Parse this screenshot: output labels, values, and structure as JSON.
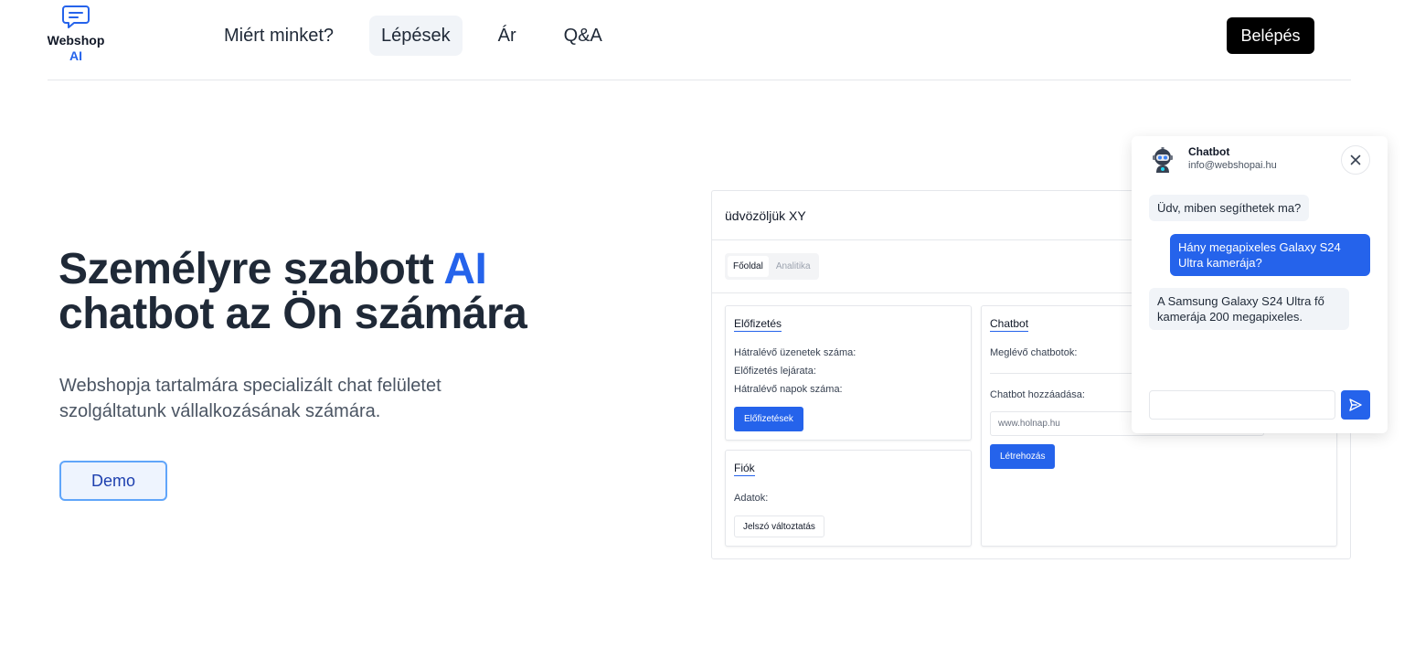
{
  "header": {
    "logo_line1": "Webshop",
    "logo_line2": "AI",
    "nav": [
      {
        "label": "Miért minket?"
      },
      {
        "label": "Lépések"
      },
      {
        "label": "Ár"
      },
      {
        "label": "Q&A"
      }
    ],
    "active_nav": "Lépések",
    "login_label": "Belépés"
  },
  "hero": {
    "title_part1": "Személyre szabott ",
    "title_accent": "AI",
    "title_part2": "chatbot az Ön számára",
    "subtitle": "Webshopja tartalmára specializált chat felületet szolgáltatunk vállalkozásának számára.",
    "demo_label": "Demo"
  },
  "dashboard": {
    "greeting": "üdvözöljük XY",
    "tabs": [
      "Főoldal",
      "Analitika"
    ],
    "active_tab": "Főoldal",
    "subscription": {
      "title": "Előfizetés",
      "lines": [
        "Hátralévő üzenetek száma:",
        "Előfizetés lejárata:",
        "Hátralévő napok száma:"
      ],
      "button": "Előfizetések"
    },
    "account": {
      "title": "Fiók",
      "data_label": "Adatok:",
      "button": "Jelszó változtatás"
    },
    "chatbot": {
      "title": "Chatbot",
      "existing_label": "Meglévő chatbotok:",
      "add_label": "Chatbot hozzáadása:",
      "url_placeholder": "www.holnap.hu",
      "button": "Létrehozás"
    }
  },
  "chat_widget": {
    "name": "Chatbot",
    "email": "info@webshopai.hu",
    "messages": [
      {
        "from": "bot",
        "text": "Üdv, miben segíthetek ma?"
      },
      {
        "from": "user",
        "text": "Hány megapixeles Galaxy S24 Ultra kamerája?"
      },
      {
        "from": "bot",
        "text": "A Samsung Galaxy S24 Ultra fő kamerája 200 megapixeles."
      }
    ],
    "input_value": ""
  },
  "colors": {
    "accent": "#2563eb",
    "text": "#1f2937",
    "login_bg": "#000000"
  }
}
